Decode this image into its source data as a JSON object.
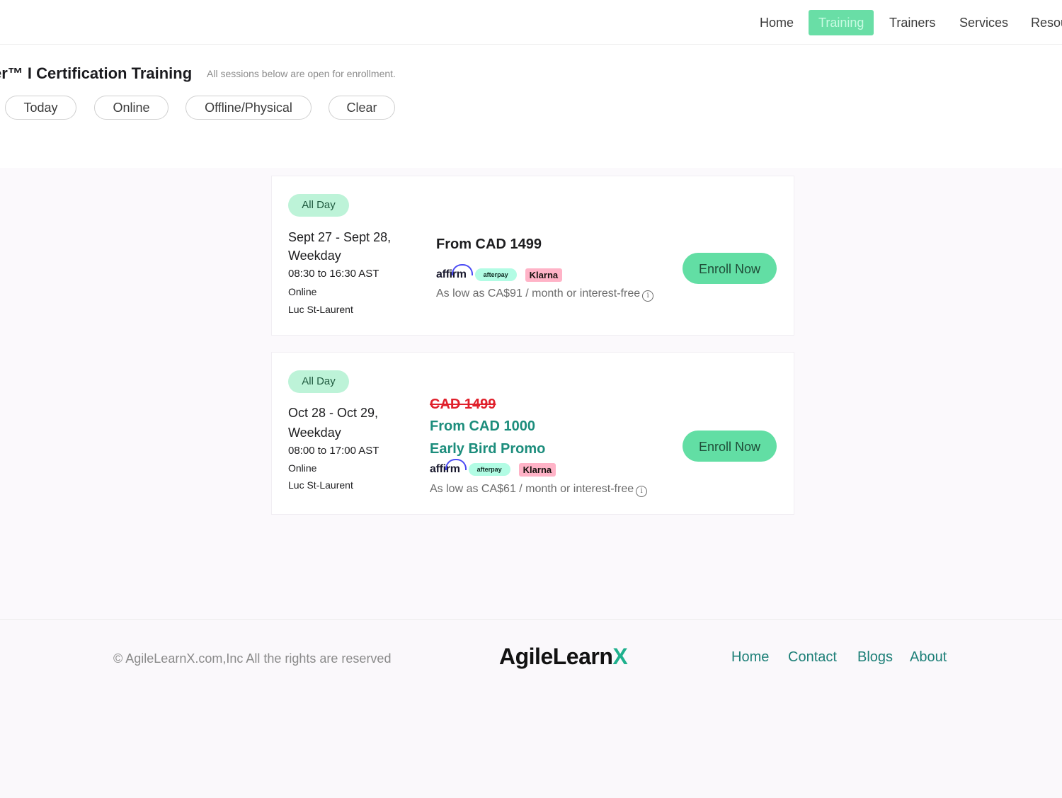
{
  "nav": {
    "items": [
      {
        "label": "Home",
        "active": false
      },
      {
        "label": "Training",
        "active": true
      },
      {
        "label": "Trainers",
        "active": false
      },
      {
        "label": "Services",
        "active": false
      },
      {
        "label": "Resou",
        "active": false
      }
    ]
  },
  "header": {
    "title": "er™ I Certification Training",
    "subtitle": "All sessions below are open for enrollment.",
    "filters": [
      "Today",
      "Online",
      "Offline/Physical",
      "Clear"
    ]
  },
  "sessions": [
    {
      "badge": "All Day",
      "dates": "Sept 27 - Sept 28,",
      "weekday": "Weekday",
      "time": "08:30 to 16:30 AST",
      "mode": "Online",
      "trainer": "Luc St-Laurent",
      "price": "From CAD 1499",
      "affirm": "affirm",
      "afterpay": "afterpay",
      "klarna": "Klarna",
      "installment": "As low as CA$91 / month or interest-free",
      "info_icon": "i",
      "enroll": "Enroll Now"
    },
    {
      "badge": "All Day",
      "dates": "Oct 28 - Oct 29,",
      "weekday": "Weekday",
      "time": "08:00 to 17:00 AST",
      "mode": "Online",
      "trainer": "Luc St-Laurent",
      "original_price": "CAD 1499",
      "price": "From CAD 1000",
      "promo": "Early Bird Promo",
      "affirm": "affirm",
      "afterpay": "afterpay",
      "klarna": "Klarna",
      "installment": "As low as CA$61 / month or interest-free",
      "info_icon": "i",
      "enroll": "Enroll Now"
    }
  ],
  "footer": {
    "copyright": "© AgileLearnX.com,Inc All the rights are reserved",
    "brand_main": "AgileLearn",
    "brand_x": "X",
    "links": [
      "Home",
      "Contact",
      "Blogs",
      "About"
    ]
  },
  "colors": {
    "accent": "#62dea4",
    "promo": "#1c8d7c",
    "strike": "#e0202b",
    "footer_link": "#1c7f77"
  }
}
